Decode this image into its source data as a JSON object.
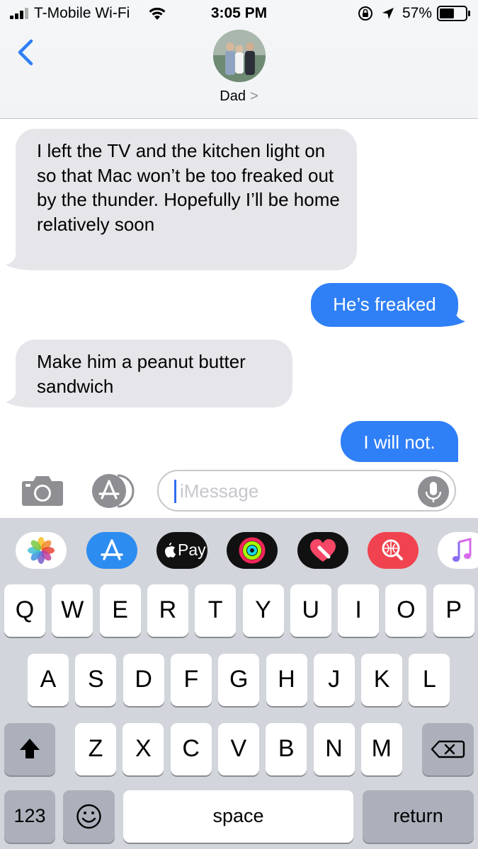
{
  "status_bar": {
    "carrier": "T-Mobile Wi-Fi",
    "time": "3:05 PM",
    "battery": "57%",
    "signal_icon": "signal-bars-icon",
    "wifi_icon": "wifi-icon",
    "lock_icon": "rotation-lock-icon",
    "location_icon": "location-arrow-icon",
    "battery_level": 0.57
  },
  "header": {
    "back_icon": "chevron-left-icon",
    "contact_name": "Dad",
    "contact_chevron": ">"
  },
  "messages": [
    {
      "direction": "incoming",
      "text": "I left the TV and the kitchen light on so that Mac won’t be too freaked out by the thunder. Hopefully I’ll be home relatively soon"
    },
    {
      "direction": "outgoing",
      "text": "He’s freaked"
    },
    {
      "direction": "incoming",
      "text": "Make him a peanut butter sandwich"
    },
    {
      "direction": "outgoing",
      "text": "I will not."
    }
  ],
  "input_bar": {
    "camera_icon": "camera-icon",
    "apps_icon": "app-store-icon",
    "placeholder": "iMessage",
    "mic_icon": "microphone-icon"
  },
  "app_strip": [
    {
      "name": "Photos",
      "icon": "photos-icon"
    },
    {
      "name": "App Store",
      "icon": "app-store-icon"
    },
    {
      "name": "Apple Pay",
      "label": "Pay",
      "icon": "apple-pay-icon"
    },
    {
      "name": "Activity",
      "icon": "activity-rings-icon"
    },
    {
      "name": "Digital Touch",
      "icon": "digital-touch-heart-icon"
    },
    {
      "name": "Search Images",
      "icon": "image-search-icon"
    },
    {
      "name": "Music",
      "icon": "music-note-icon"
    }
  ],
  "keyboard": {
    "row1": [
      "Q",
      "W",
      "E",
      "R",
      "T",
      "Y",
      "U",
      "I",
      "O",
      "P"
    ],
    "row2": [
      "A",
      "S",
      "D",
      "F",
      "G",
      "H",
      "J",
      "K",
      "L"
    ],
    "row3": [
      "Z",
      "X",
      "C",
      "V",
      "B",
      "N",
      "M"
    ],
    "shift_icon": "shift-arrow-icon",
    "delete_icon": "backspace-icon",
    "numbers_label": "123",
    "emoji_icon": "emoji-icon",
    "space_label": "space",
    "return_label": "return"
  },
  "colors": {
    "outgoing_bubble": "#2f7ff6",
    "incoming_bubble": "#e5e5ea",
    "accent": "#2f7ff6"
  }
}
